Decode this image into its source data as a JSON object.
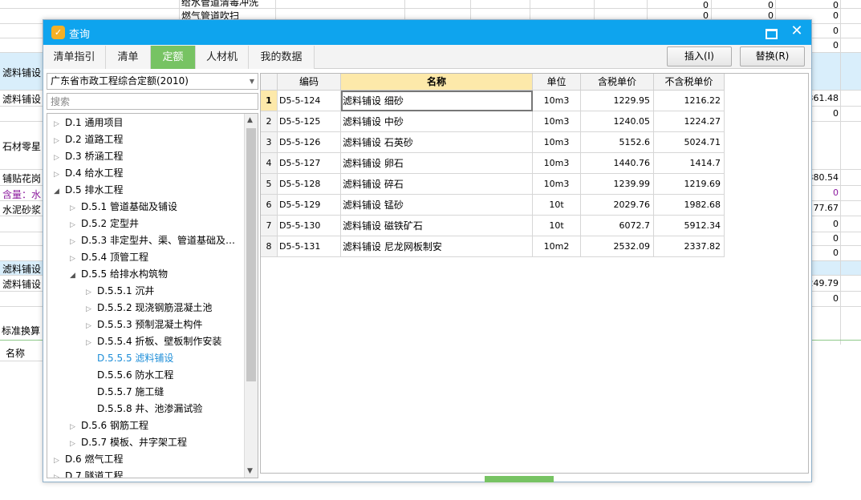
{
  "background": {
    "rows": [
      {
        "left": "",
        "values": [
          "0",
          "0",
          "0"
        ]
      },
      {
        "left": "",
        "values": [
          "0",
          "0",
          "0"
        ]
      },
      {
        "left": "",
        "values": [
          "",
          "",
          "0"
        ]
      },
      {
        "left": "",
        "values": [
          "",
          "",
          "0"
        ]
      },
      {
        "left": "滤料铺设",
        "values": [
          "",
          "",
          ""
        ]
      },
      {
        "left": "滤料铺设",
        "values": [
          "",
          "",
          "361.48"
        ]
      },
      {
        "left": "",
        "values": [
          "",
          "",
          "0"
        ]
      },
      {
        "left": "石材零星",
        "values": [
          "",
          "",
          ""
        ]
      },
      {
        "left": "铺贴花岗",
        "values": [
          "",
          "",
          "380.54"
        ]
      },
      {
        "left": "含量：水",
        "values": [
          "",
          "",
          "0"
        ]
      },
      {
        "left": "水泥砂浆",
        "values": [
          "",
          "",
          "77.67"
        ]
      },
      {
        "left": "",
        "values": [
          "",
          "",
          "0"
        ]
      },
      {
        "left": "",
        "values": [
          "",
          "",
          "0"
        ]
      },
      {
        "left": "",
        "values": [
          "",
          "",
          "0"
        ]
      },
      {
        "left": "滤料铺设",
        "values": [
          "",
          "",
          ""
        ]
      },
      {
        "left": "滤料铺设",
        "values": [
          "",
          "",
          "249.79"
        ]
      },
      {
        "left": "",
        "values": [
          "",
          "",
          "0"
        ]
      }
    ],
    "top_texts": [
      "给水管道清毒冲洗",
      "燃气管道吹扫"
    ],
    "bottom_label": "标准换算",
    "bottom_header": "名称"
  },
  "dialog": {
    "title": "查询",
    "tabs": [
      "清单指引",
      "清单",
      "定额",
      "人材机",
      "我的数据"
    ],
    "active_tab": 2,
    "insert_label": "插入(I)",
    "replace_label": "替换(R)",
    "dropdown_value": "广东省市政工程综合定额(2010)",
    "search_placeholder": "搜索",
    "tree": [
      {
        "level": 0,
        "expanded": false,
        "label": "D.1 通用项目"
      },
      {
        "level": 0,
        "expanded": false,
        "label": "D.2 道路工程"
      },
      {
        "level": 0,
        "expanded": false,
        "label": "D.3 桥涵工程"
      },
      {
        "level": 0,
        "expanded": false,
        "label": "D.4 给水工程"
      },
      {
        "level": 0,
        "expanded": true,
        "label": "D.5 排水工程"
      },
      {
        "level": 1,
        "expanded": false,
        "label": "D.5.1 管道基础及铺设"
      },
      {
        "level": 1,
        "expanded": false,
        "label": "D.5.2 定型井"
      },
      {
        "level": 1,
        "expanded": false,
        "label": "D.5.3 非定型井、渠、管道基础及…"
      },
      {
        "level": 1,
        "expanded": false,
        "label": "D.5.4 顶管工程"
      },
      {
        "level": 1,
        "expanded": true,
        "label": "D.5.5 给排水构筑物"
      },
      {
        "level": 2,
        "expanded": false,
        "label": "D.5.5.1 沉井"
      },
      {
        "level": 2,
        "expanded": false,
        "label": "D.5.5.2 现浇钢筋混凝土池"
      },
      {
        "level": 2,
        "expanded": false,
        "label": "D.5.5.3 预制混凝土构件"
      },
      {
        "level": 2,
        "expanded": false,
        "label": "D.5.5.4 折板、壁板制作安装"
      },
      {
        "level": 2,
        "leaf": true,
        "selected": true,
        "label": "D.5.5.5 滤料铺设"
      },
      {
        "level": 2,
        "leaf": true,
        "label": "D.5.5.6 防水工程"
      },
      {
        "level": 2,
        "leaf": true,
        "label": "D.5.5.7 施工缝"
      },
      {
        "level": 2,
        "leaf": true,
        "label": "D.5.5.8 井、池渗漏试验"
      },
      {
        "level": 1,
        "expanded": false,
        "label": "D.5.6 钢筋工程"
      },
      {
        "level": 1,
        "expanded": false,
        "label": "D.5.7 模板、井字架工程"
      },
      {
        "level": 0,
        "expanded": false,
        "label": "D.6 燃气工程"
      },
      {
        "level": 0,
        "expanded": false,
        "label": "D.7 隧道工程"
      }
    ],
    "grid": {
      "headers": [
        "",
        "编码",
        "名称",
        "单位",
        "含税单价",
        "不含税单价"
      ],
      "rows": [
        {
          "no": "1",
          "code": "D5-5-124",
          "name": "滤料铺设 细砂",
          "unit": "10m3",
          "tax_price": "1229.95",
          "notax_price": "1216.22"
        },
        {
          "no": "2",
          "code": "D5-5-125",
          "name": "滤料铺设 中砂",
          "unit": "10m3",
          "tax_price": "1240.05",
          "notax_price": "1224.27"
        },
        {
          "no": "3",
          "code": "D5-5-126",
          "name": "滤料铺设 石英砂",
          "unit": "10m3",
          "tax_price": "5152.6",
          "notax_price": "5024.71"
        },
        {
          "no": "4",
          "code": "D5-5-127",
          "name": "滤料铺设 卵石",
          "unit": "10m3",
          "tax_price": "1440.76",
          "notax_price": "1414.7"
        },
        {
          "no": "5",
          "code": "D5-5-128",
          "name": "滤料铺设 碎石",
          "unit": "10m3",
          "tax_price": "1239.99",
          "notax_price": "1219.69"
        },
        {
          "no": "6",
          "code": "D5-5-129",
          "name": "滤料铺设 锰砂",
          "unit": "10t",
          "tax_price": "2029.76",
          "notax_price": "1982.68"
        },
        {
          "no": "7",
          "code": "D5-5-130",
          "name": "滤料铺设 磁铁矿石",
          "unit": "10t",
          "tax_price": "6072.7",
          "notax_price": "5912.34"
        },
        {
          "no": "8",
          "code": "D5-5-131",
          "name": "滤料铺设 尼龙网板制安",
          "unit": "10m2",
          "tax_price": "2532.09",
          "notax_price": "2337.82"
        }
      ]
    }
  },
  "colors": {
    "title_bar": "#0ea4ee",
    "active_tab": "#77c363",
    "header_highlight": "#fde9aa",
    "selected_tree": "#1e8ed8"
  }
}
